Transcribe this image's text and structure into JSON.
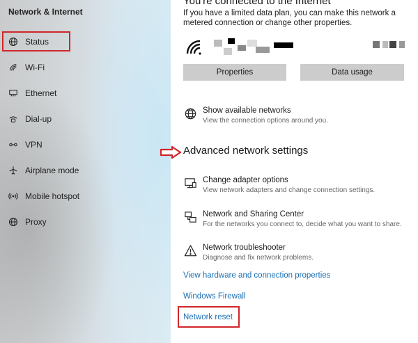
{
  "sidebar": {
    "title": "Network & Internet",
    "items": [
      {
        "label": "Status",
        "icon": "globe-icon"
      },
      {
        "label": "Wi-Fi",
        "icon": "wifi-icon"
      },
      {
        "label": "Ethernet",
        "icon": "ethernet-icon"
      },
      {
        "label": "Dial-up",
        "icon": "dialup-icon"
      },
      {
        "label": "VPN",
        "icon": "vpn-icon"
      },
      {
        "label": "Airplane mode",
        "icon": "airplane-icon"
      },
      {
        "label": "Mobile hotspot",
        "icon": "hotspot-icon"
      },
      {
        "label": "Proxy",
        "icon": "globe-icon"
      }
    ]
  },
  "main": {
    "connection_heading": "You're connected to the Internet",
    "connection_desc": "If you have a limited data plan, you can make this network a metered connection or change other properties.",
    "buttons": {
      "properties": "Properties",
      "data_usage": "Data usage"
    },
    "show_networks": {
      "title": "Show available networks",
      "subtitle": "View the connection options around you."
    },
    "advanced_heading": "Advanced network settings",
    "adapter": {
      "title": "Change adapter options",
      "subtitle": "View network adapters and change connection settings."
    },
    "sharing": {
      "title": "Network and Sharing Center",
      "subtitle": "For the networks you connect to, decide what you want to share."
    },
    "troubleshooter": {
      "title": "Network troubleshooter",
      "subtitle": "Diagnose and fix network problems."
    },
    "links": {
      "hardware": "View hardware and connection properties",
      "firewall": "Windows Firewall",
      "reset": "Network reset"
    }
  },
  "colors": {
    "accent_link": "#1a6fb3",
    "highlight_red": "#d0262a",
    "button_gray": "#cccccc"
  }
}
